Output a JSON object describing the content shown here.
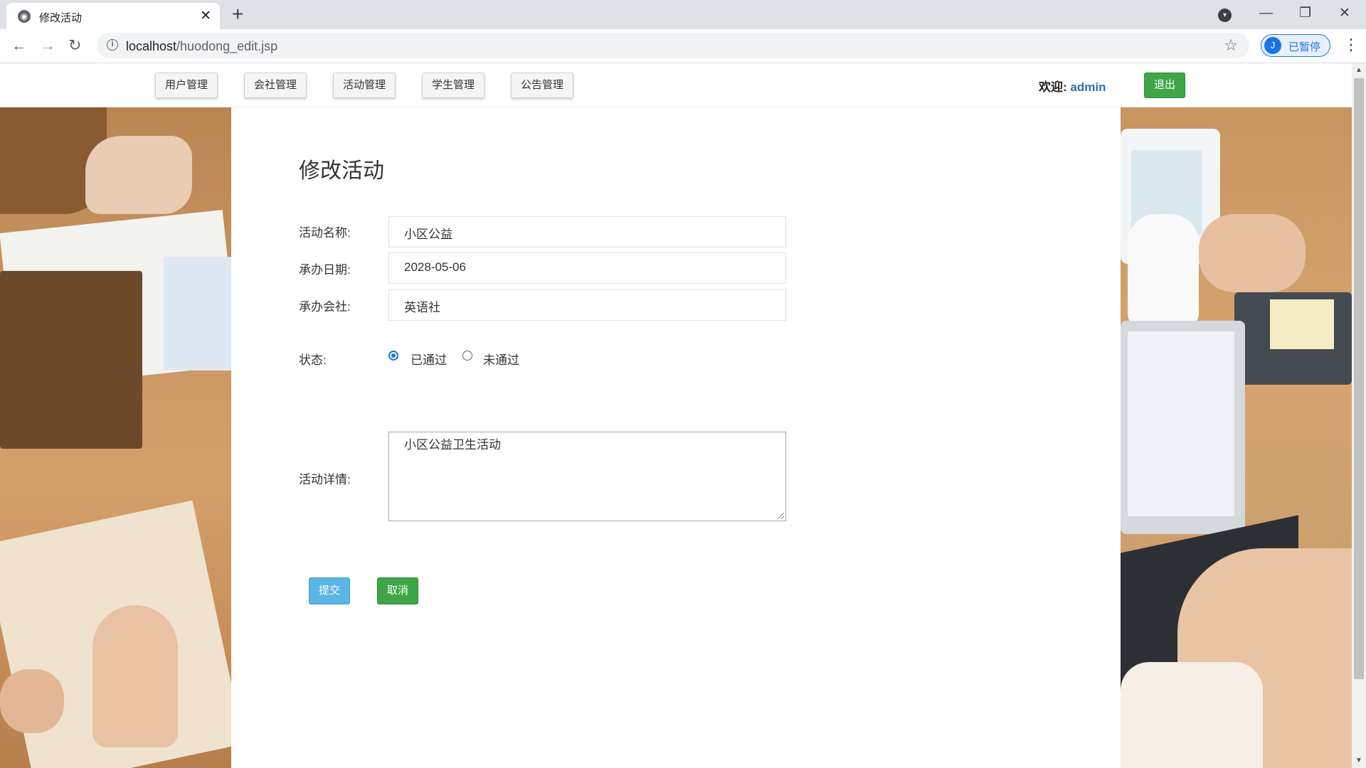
{
  "browser": {
    "tab_title": "修改活动",
    "tab_close": "✕",
    "new_tab": "+",
    "url_host": "localhost",
    "url_path": "/huodong_edit.jsp",
    "profile_initial": "J",
    "profile_status": "已暂停"
  },
  "nav": {
    "items": [
      "用户管理",
      "会社管理",
      "活动管理",
      "学生管理",
      "公告管理"
    ],
    "welcome_label": "欢迎:",
    "username": "admin",
    "logout_label": "退出"
  },
  "form": {
    "title": "修改活动",
    "fields": {
      "name": {
        "label": "活动名称:",
        "value": "小区公益"
      },
      "date": {
        "label": "承办日期:",
        "value": "2028-05-06"
      },
      "club": {
        "label": "承办会社:",
        "value": "英语社"
      },
      "status": {
        "label": "状态:",
        "options": [
          "已通过",
          "未通过"
        ],
        "selected": "已通过"
      },
      "detail": {
        "label": "活动详情:",
        "value": "小区公益卫生活动"
      }
    },
    "submit_label": "提交",
    "cancel_label": "取消"
  },
  "colors": {
    "primary_green": "#3fa648",
    "primary_blue": "#5bb6e5",
    "link_blue": "#2f6fb0"
  }
}
